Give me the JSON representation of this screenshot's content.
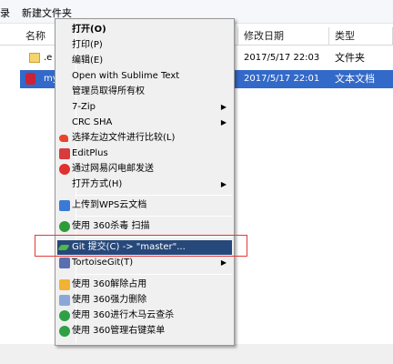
{
  "toolbar": {
    "edge_char": "录",
    "new_folder": "新建文件夹"
  },
  "columns": {
    "name": "名称",
    "modified": "修改日期",
    "type": "类型"
  },
  "files": [
    {
      "name_fragment": ".e",
      "modified": "2017/5/17 22:03",
      "type": "文件夹"
    },
    {
      "name_fragment": "my",
      "modified": "2017/5/17 22:01",
      "type": "文本文档"
    }
  ],
  "menu": {
    "items": [
      {
        "label": "打开(O)",
        "bold": true
      },
      {
        "label": "打印(P)"
      },
      {
        "label": "编辑(E)"
      },
      {
        "label": "Open with Sublime Text"
      },
      {
        "label": "管理员取得所有权"
      },
      {
        "label": "7-Zip",
        "submenu": true
      },
      {
        "label": "CRC SHA",
        "submenu": true
      },
      {
        "label": "选择左边文件进行比较(L)",
        "icon": "compare-icon"
      },
      {
        "label": "EditPlus",
        "icon": "editplus-icon"
      },
      {
        "label": "通过网易闪电邮发送",
        "icon": "netease-mail-icon"
      },
      {
        "label": "打开方式(H)",
        "submenu": true
      },
      {
        "label": "上传到WPS云文档",
        "icon": "wps-cloud-icon"
      },
      {
        "label": "使用 360杀毒 扫描",
        "icon": "360-antivirus-icon"
      },
      {
        "label": "Git 提交(C) -> \"master\"...",
        "icon": "git-commit-icon",
        "highlighted": true
      },
      {
        "label": "TortoiseGit(T)",
        "icon": "tortoisegit-icon",
        "submenu": true
      },
      {
        "label": "使用 360解除占用",
        "icon": "360-unlock-icon"
      },
      {
        "label": "使用 360强力删除",
        "icon": "360-delete-icon"
      },
      {
        "label": "使用 360进行木马云查杀",
        "icon": "360-trojan-scan-icon"
      },
      {
        "label": "使用 360管理右键菜单",
        "icon": "360-menu-manager-icon"
      }
    ]
  },
  "colors": {
    "selection": "#3369c8",
    "menu_highlight": "#27487a",
    "callout": "#e23a3a"
  }
}
